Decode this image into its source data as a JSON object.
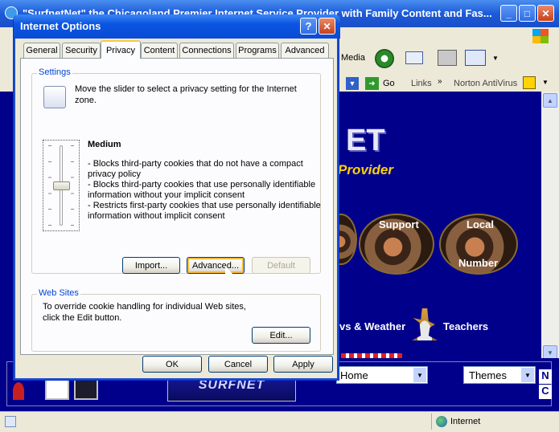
{
  "ie": {
    "title": "\"SurfnetNet\" the Chicagoland Premier Internet Service Provider with Family Content and Fas...",
    "toolbar": {
      "media_label": "Media",
      "go_label": "Go",
      "links_label": "Links",
      "norton_label": "Norton AntiVirus"
    }
  },
  "site": {
    "logo_text": "ET",
    "provider_text": "Provider",
    "support_label": "Support",
    "local_label": "Local",
    "number_label": "Number",
    "weather_label": "vs & Weather",
    "teachers_label": "Teachers",
    "home_select": "Home",
    "themes_select": "Themes",
    "side_letters": [
      "N",
      "C"
    ],
    "brand": "SURFNET"
  },
  "status": {
    "zone": "Internet"
  },
  "dialog": {
    "title": "Internet Options",
    "tabs": [
      "General",
      "Security",
      "Privacy",
      "Content",
      "Connections",
      "Programs",
      "Advanced"
    ],
    "active_tab": "Privacy",
    "settings_group": "Settings",
    "slider_instruction_1": "Move the slider to select a privacy setting for the Internet",
    "slider_instruction_2": "zone.",
    "level_name": "Medium",
    "level_value": 0.5,
    "description": [
      "- Blocks third-party cookies that do not have a compact",
      "privacy policy",
      "- Blocks third-party cookies that use personally identifiable",
      "information without your implicit consent",
      "- Restricts first-party cookies that use personally identifiable",
      "information without implicit consent"
    ],
    "import_button": "Import...",
    "advanced_button": "Advanced...",
    "default_button": "Default",
    "websites_group": "Web Sites",
    "websites_text_1": "To override cookie handling for individual Web sites,",
    "websites_text_2": "click the Edit button.",
    "edit_button": "Edit...",
    "ok_button": "OK",
    "cancel_button": "Cancel",
    "apply_button": "Apply"
  },
  "colors": {
    "xp_blue": "#0a55e0",
    "site_bg": "#00008b",
    "accent_yellow": "#ffd200"
  }
}
